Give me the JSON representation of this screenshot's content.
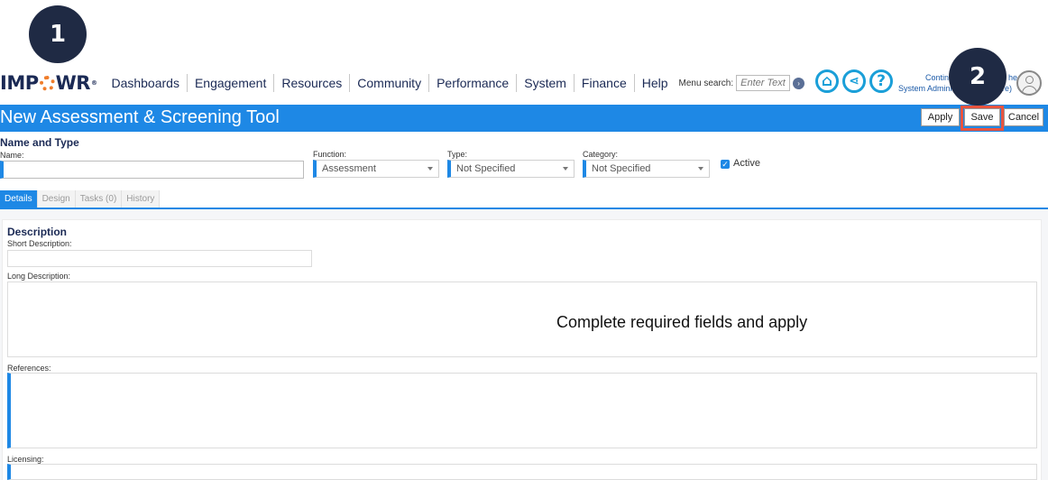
{
  "steps": {
    "step1": "1",
    "step2": "2"
  },
  "logo": {
    "left": "IMP",
    "right": "WR",
    "tm": "®"
  },
  "nav": {
    "items": [
      "Dashboards",
      "Engagement",
      "Resources",
      "Community",
      "Performance",
      "System",
      "Finance",
      "Help"
    ],
    "search_label": "Menu search:",
    "search_placeholder": "Enter Text"
  },
  "header_icons": [
    "home-icon",
    "share-icon",
    "help-icon"
  ],
  "user": {
    "line1": "Contin",
    "line1_tail": "he",
    "line2": "System Admini",
    "line2_tail": "re)"
  },
  "page": {
    "title": "New Assessment & Screening Tool",
    "apply": "Apply",
    "save": "Save",
    "cancel": "Cancel"
  },
  "name_type": {
    "heading": "Name and Type",
    "name_label": "Name:",
    "name_value": "",
    "function_label": "Function:",
    "function_value": "Assessment",
    "type_label": "Type:",
    "type_value": "Not Specified",
    "category_label": "Category:",
    "category_value": "Not Specified",
    "active_label": "Active",
    "active_checked": true
  },
  "tabs": [
    "Details",
    "Design",
    "Tasks (0)",
    "History"
  ],
  "details": {
    "heading": "Description",
    "short_label": "Short Description:",
    "long_label": "Long Description:",
    "references_label": "References:",
    "licensing_label": "Licensing:"
  },
  "annotation": "Complete required fields and apply",
  "colors": {
    "brand_blue": "#1e88e5",
    "navy": "#1b2a55",
    "highlight": "#e8543f",
    "badge": "#1f2a44"
  }
}
